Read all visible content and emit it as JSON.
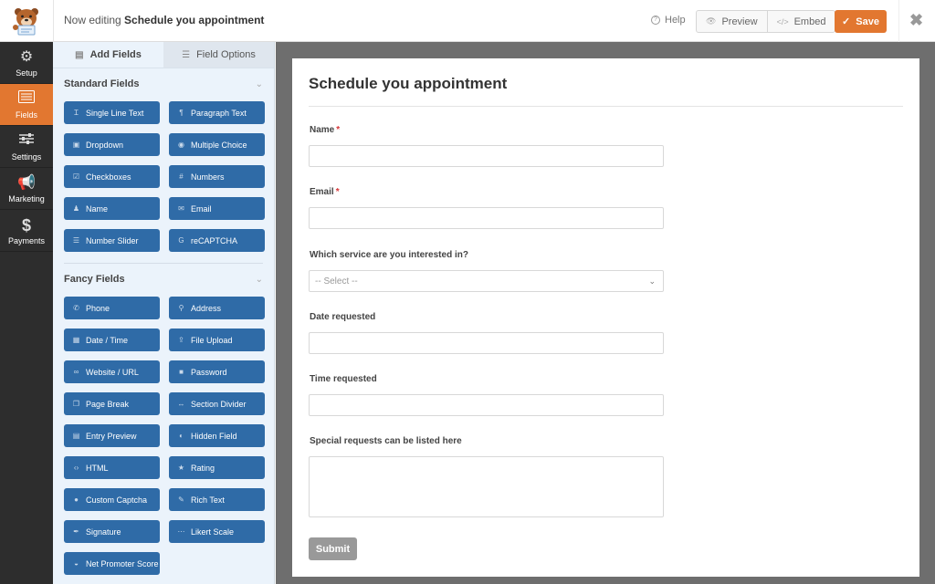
{
  "header": {
    "editing_prefix": "Now editing",
    "form_name": "Schedule you appointment",
    "help_label": "Help",
    "preview_label": "Preview",
    "embed_label": "Embed",
    "save_label": "Save",
    "accent_color": "#e27730"
  },
  "leftnav": {
    "items": [
      {
        "label": "Setup",
        "icon": "gear-icon",
        "active": false
      },
      {
        "label": "Fields",
        "icon": "list-icon",
        "active": true
      },
      {
        "label": "Settings",
        "icon": "sliders-icon",
        "active": false
      },
      {
        "label": "Marketing",
        "icon": "megaphone-icon",
        "active": false
      },
      {
        "label": "Payments",
        "icon": "dollar-icon",
        "active": false
      }
    ]
  },
  "panel": {
    "tabs": [
      {
        "label": "Add Fields",
        "icon": "list-icon",
        "active": true
      },
      {
        "label": "Field Options",
        "icon": "sliders-icon",
        "active": false
      }
    ],
    "standard": {
      "title": "Standard Fields",
      "fields": [
        {
          "label": "Single Line Text",
          "icon": "text-cursor-icon",
          "glyph": "Ɪ"
        },
        {
          "label": "Paragraph Text",
          "icon": "paragraph-icon",
          "glyph": "¶"
        },
        {
          "label": "Dropdown",
          "icon": "dropdown-icon",
          "glyph": "▣"
        },
        {
          "label": "Multiple Choice",
          "icon": "radio-icon",
          "glyph": "◉"
        },
        {
          "label": "Checkboxes",
          "icon": "checkbox-icon",
          "glyph": "☑"
        },
        {
          "label": "Numbers",
          "icon": "hash-icon",
          "glyph": "#"
        },
        {
          "label": "Name",
          "icon": "user-icon",
          "glyph": "♟"
        },
        {
          "label": "Email",
          "icon": "envelope-icon",
          "glyph": "✉"
        },
        {
          "label": "Number Slider",
          "icon": "slider-icon",
          "glyph": "☰"
        },
        {
          "label": "reCAPTCHA",
          "icon": "google-icon",
          "glyph": "G"
        }
      ]
    },
    "fancy": {
      "title": "Fancy Fields",
      "fields": [
        {
          "label": "Phone",
          "icon": "phone-icon",
          "glyph": "✆"
        },
        {
          "label": "Address",
          "icon": "map-pin-icon",
          "glyph": "⚲"
        },
        {
          "label": "Date / Time",
          "icon": "calendar-icon",
          "glyph": "▦"
        },
        {
          "label": "File Upload",
          "icon": "upload-icon",
          "glyph": "⇪"
        },
        {
          "label": "Website / URL",
          "icon": "link-icon",
          "glyph": "∞"
        },
        {
          "label": "Password",
          "icon": "lock-icon",
          "glyph": "■"
        },
        {
          "label": "Page Break",
          "icon": "copy-icon",
          "glyph": "❐"
        },
        {
          "label": "Section Divider",
          "icon": "divider-icon",
          "glyph": "↔"
        },
        {
          "label": "Entry Preview",
          "icon": "file-icon",
          "glyph": "▤"
        },
        {
          "label": "Hidden Field",
          "icon": "eye-slash-icon",
          "glyph": "◐"
        },
        {
          "label": "HTML",
          "icon": "code-icon",
          "glyph": "‹›"
        },
        {
          "label": "Rating",
          "icon": "star-icon",
          "glyph": "★"
        },
        {
          "label": "Custom Captcha",
          "icon": "question-circle-icon",
          "glyph": "●"
        },
        {
          "label": "Rich Text",
          "icon": "edit-icon",
          "glyph": "✎"
        },
        {
          "label": "Signature",
          "icon": "pen-icon",
          "glyph": "✒"
        },
        {
          "label": "Likert Scale",
          "icon": "ellipsis-icon",
          "glyph": "⋯"
        },
        {
          "label": "Net Promoter Score",
          "icon": "gauge-icon",
          "glyph": "◒"
        }
      ]
    }
  },
  "form": {
    "title": "Schedule you appointment",
    "fields": [
      {
        "label": "Name",
        "required": true,
        "type": "text",
        "value": ""
      },
      {
        "label": "Email",
        "required": true,
        "type": "text",
        "value": ""
      },
      {
        "label": "Which service are you interested in?",
        "required": false,
        "type": "select",
        "selected": "-- Select --"
      },
      {
        "label": "Date requested",
        "required": false,
        "type": "text",
        "value": ""
      },
      {
        "label": "Time requested",
        "required": false,
        "type": "text",
        "value": ""
      },
      {
        "label": "Special requests can be listed here",
        "required": false,
        "type": "textarea",
        "value": ""
      }
    ],
    "required_marker": "*",
    "submit_label": "Submit"
  }
}
